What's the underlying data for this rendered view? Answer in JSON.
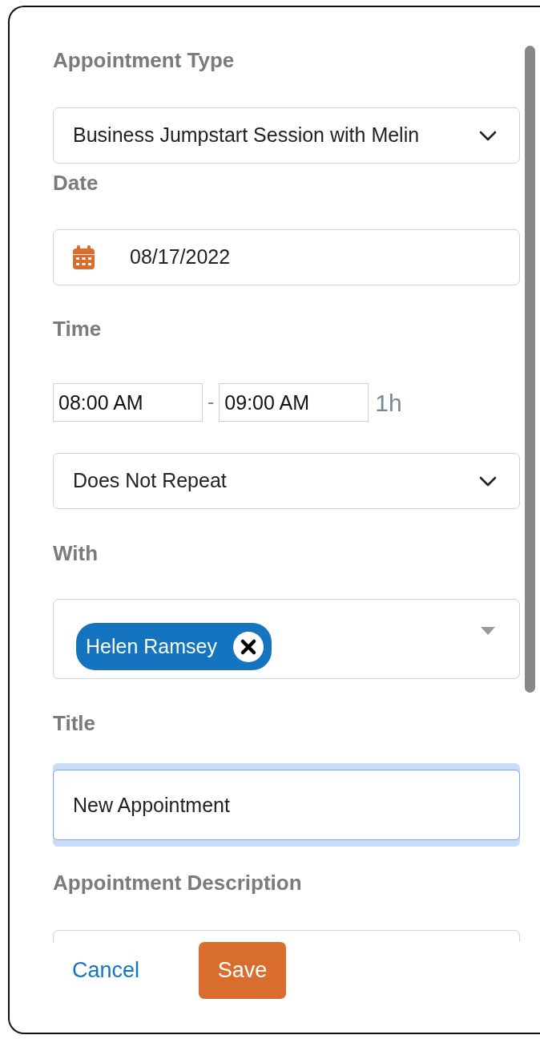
{
  "fields": [
    {
      "kind": "select",
      "label": "Appointment Type",
      "value": "Business Jumpstart Session with Melin"
    },
    {
      "kind": "date",
      "label": "Date",
      "value": "08/17/2022"
    },
    {
      "kind": "time_range",
      "label": "Time",
      "start": "08:00 AM",
      "separator": "-",
      "end": "09:00 AM",
      "duration": "1h",
      "repeat": "Does Not Repeat"
    },
    {
      "kind": "people",
      "label": "With",
      "chips": [
        {
          "name": "Helen Ramsey"
        }
      ]
    },
    {
      "kind": "text",
      "label": "Title",
      "value": "New Appointment",
      "focused": true
    },
    {
      "kind": "textarea",
      "label": "Appointment Description"
    }
  ],
  "actions": {
    "cancel": "Cancel",
    "save": "Save"
  }
}
